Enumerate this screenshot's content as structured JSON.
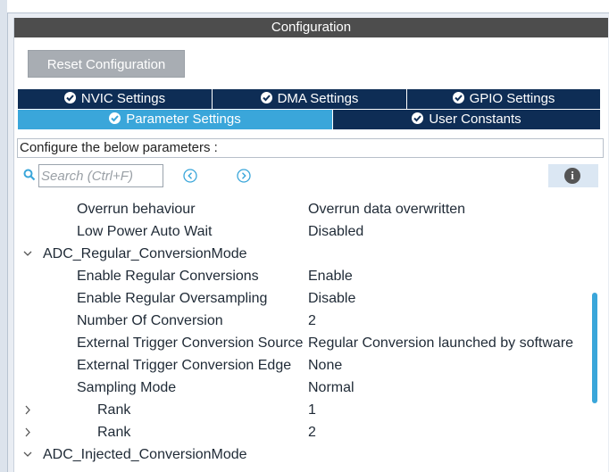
{
  "title": "Configuration",
  "reset_button": "Reset Configuration",
  "tabs_row1": [
    "NVIC Settings",
    "DMA Settings",
    "GPIO Settings"
  ],
  "tabs_row2": [
    "Parameter Settings",
    "User Constants"
  ],
  "config_label": "Configure the below parameters :",
  "search": {
    "placeholder": "Search (Ctrl+F)"
  },
  "rows": {
    "overrun_label": "Overrun behaviour",
    "overrun_value": "Overrun data overwritten",
    "lowpower_label": "Low Power Auto Wait",
    "lowpower_value": "Disabled",
    "regular_group": "ADC_Regular_ConversionMode",
    "enable_regular_label": "Enable Regular Conversions",
    "enable_regular_value": "Enable",
    "oversampling_label": "Enable Regular Oversampling",
    "oversampling_value": "Disable",
    "num_conv_label": "Number Of Conversion",
    "num_conv_value": "2",
    "ext_source_label": "External Trigger Conversion Source",
    "ext_source_value": "Regular Conversion launched by software",
    "ext_edge_label": "External Trigger Conversion Edge",
    "ext_edge_value": "None",
    "sampling_label": "Sampling Mode",
    "sampling_value": "Normal",
    "rank1_label": "Rank",
    "rank1_value": "1",
    "rank2_label": "Rank",
    "rank2_value": "2",
    "injected_group": "ADC_Injected_ConversionMode"
  },
  "colors": {
    "tab_dark": "#0e2d55",
    "tab_active": "#3aa6da",
    "title_bar": "#4d4d4d"
  }
}
